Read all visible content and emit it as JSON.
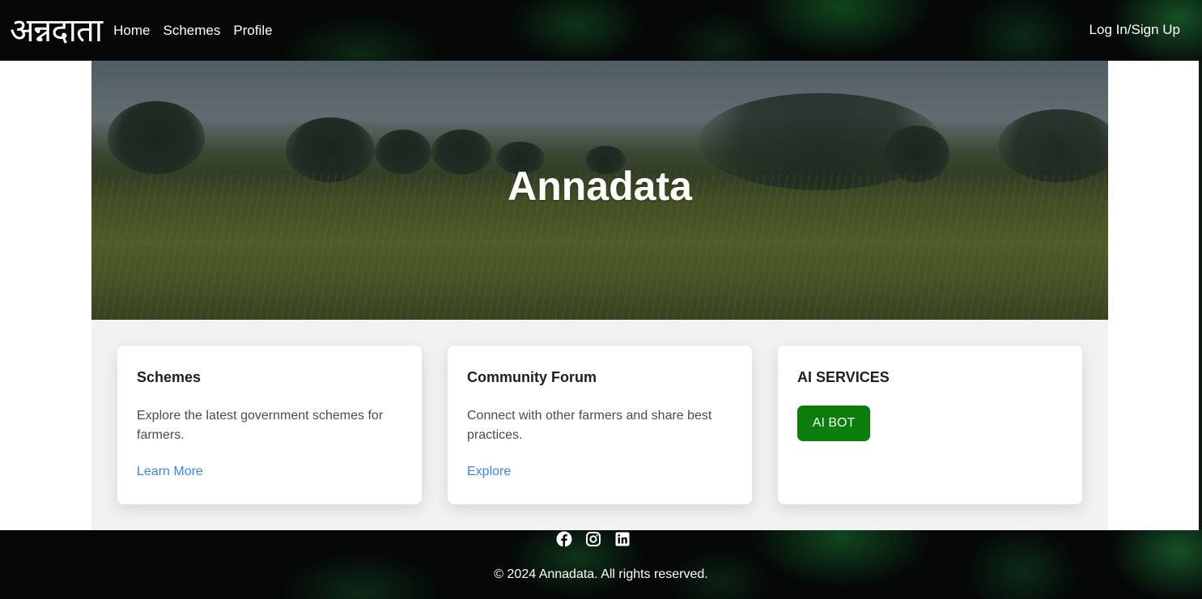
{
  "header": {
    "logo_text": "अन्नदाता",
    "nav": [
      "Home",
      "Schemes",
      "Profile"
    ],
    "login_label": "Log In/Sign Up"
  },
  "hero": {
    "title": "Annadata"
  },
  "cards": [
    {
      "title": "Schemes",
      "description": "Explore the latest government schemes for farmers.",
      "link": "Learn More"
    },
    {
      "title": "Community Forum",
      "description": "Connect with other farmers and share best practices.",
      "link": "Explore"
    },
    {
      "title": "AI SERVICES",
      "button": "AI BOT"
    }
  ],
  "footer": {
    "social_icons": [
      "facebook-icon",
      "instagram-icon",
      "linkedin-icon"
    ],
    "copyright": "© 2024 Annadata. All rights reserved."
  },
  "colors": {
    "accent_link": "#3b82f6",
    "ai_button": "#0a7d0a",
    "dark_bg": "#050807"
  }
}
